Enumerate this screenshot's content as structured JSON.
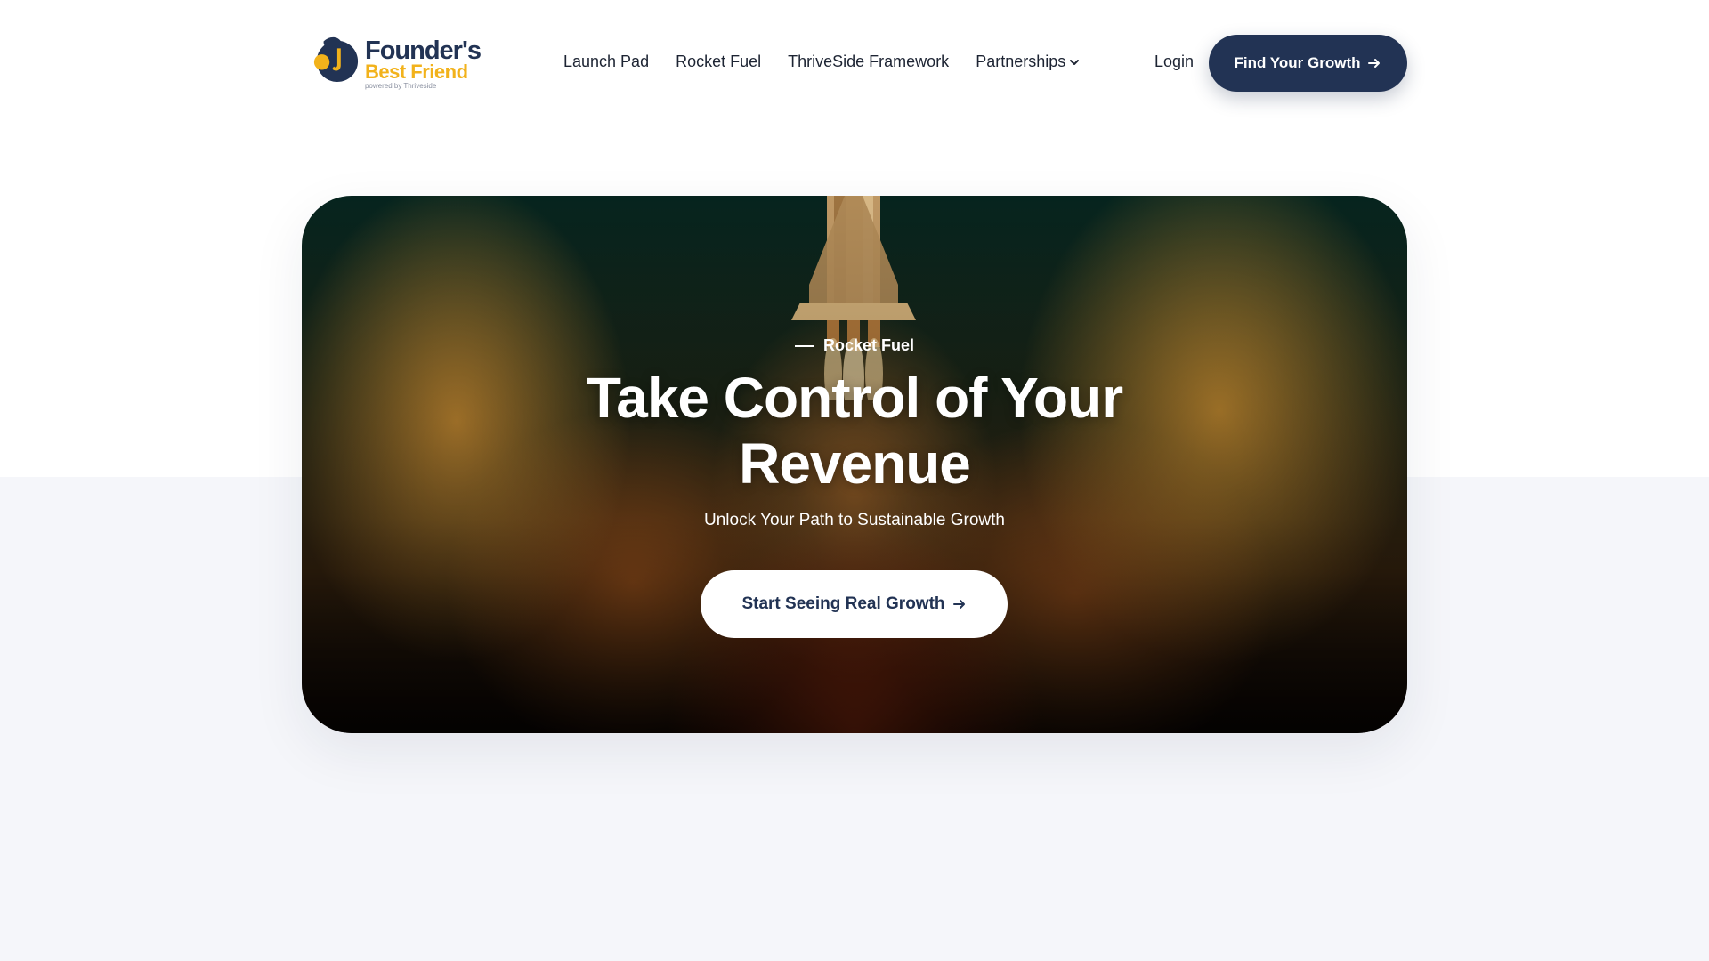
{
  "logo": {
    "line1": "Founder's",
    "line2": "Best Friend",
    "line3": "powered by Thriveside"
  },
  "nav": {
    "items": [
      {
        "label": "Launch Pad"
      },
      {
        "label": "Rocket Fuel"
      },
      {
        "label": "ThriveSide Framework"
      },
      {
        "label": "Partnerships"
      }
    ],
    "login": "Login",
    "cta": "Find Your Growth"
  },
  "hero": {
    "eyebrow": "Rocket Fuel",
    "title_line1": "Take Control of Your",
    "title_line2": "Revenue",
    "subtitle": "Unlock Your Path to Sustainable Growth",
    "cta": "Start Seeing Real Growth"
  },
  "colors": {
    "brand_navy": "#223354",
    "brand_yellow": "#f2b21b",
    "page_bg": "#f5f6fa"
  },
  "icons": {
    "partnerships_dropdown": "chevron-down-icon",
    "cta_arrow": "arrow-right-icon"
  }
}
